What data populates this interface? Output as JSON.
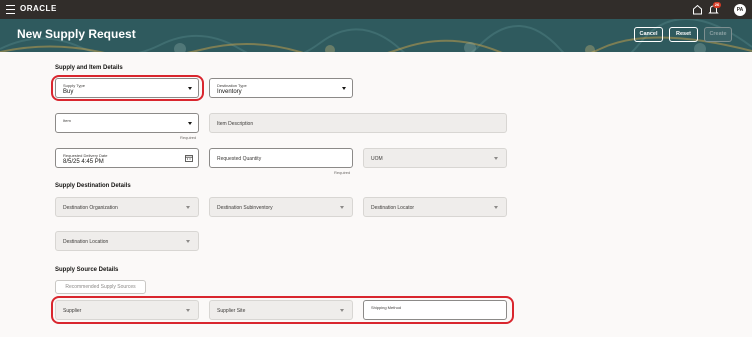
{
  "topbar": {
    "brand": "ORACLE",
    "notifications_count": "26",
    "user_initials": "PA",
    "icons": [
      "menu-icon",
      "home-icon",
      "bell-icon"
    ]
  },
  "header": {
    "title": "New Supply Request",
    "buttons": {
      "cancel": "Cancel",
      "reset": "Reset",
      "create": "Create"
    }
  },
  "supply_item": {
    "title": "Supply and Item Details",
    "supply_type": {
      "label": "Supply Type",
      "value": "Buy"
    },
    "destination_type": {
      "label": "Destination Type",
      "value": "Inventory"
    },
    "item": {
      "label": "Item",
      "value": "",
      "required": "Required"
    },
    "item_description": {
      "label": "Item Description"
    },
    "delivery_date": {
      "label": "Requested Delivery Date",
      "value": "8/5/25 4:45 PM"
    },
    "quantity": {
      "label": "Requested Quantity",
      "required": "Required"
    },
    "uom": {
      "label": "UOM"
    }
  },
  "destination": {
    "title": "Supply Destination Details",
    "organization": "Destination Organization",
    "subinventory": "Destination Subinventory",
    "locator": "Destination Locator",
    "location": "Destination Location"
  },
  "source": {
    "title": "Supply Source Details",
    "recommended_button": "Recommended Supply Sources",
    "supplier": "Supplier",
    "supplier_site": "Supplier Site",
    "shipping_method": "Shipping Method"
  },
  "colors": {
    "topbar": "#312d2a",
    "header": "#2f5a5e",
    "highlight": "#d9262e",
    "page_bg": "#fbf9f8"
  }
}
